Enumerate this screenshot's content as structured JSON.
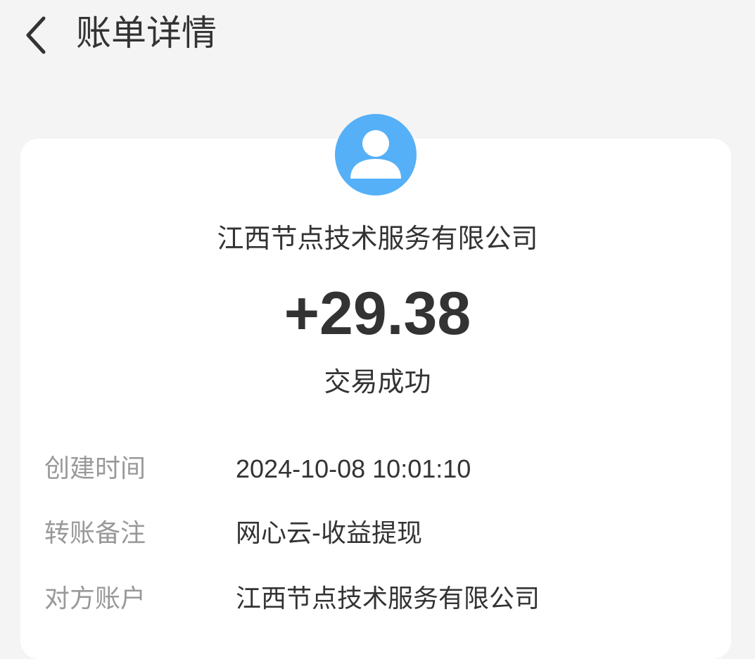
{
  "header": {
    "title": "账单详情",
    "back_icon": "chevron-left-icon"
  },
  "payer": {
    "avatar_icon": "user-avatar-icon",
    "avatar_color": "#55b0f7",
    "name": "江西节点技术服务有限公司"
  },
  "transaction": {
    "amount": "+29.38",
    "status": "交易成功"
  },
  "details": [
    {
      "label": "创建时间",
      "value": "2024-10-08 10:01:10"
    },
    {
      "label": "转账备注",
      "value": "网心云-收益提现"
    },
    {
      "label": "对方账户",
      "value": "江西节点技术服务有限公司"
    }
  ],
  "colors": {
    "background": "#f4f4f4",
    "card": "#ffffff",
    "primary_text": "#333333",
    "secondary_text": "#999999"
  }
}
